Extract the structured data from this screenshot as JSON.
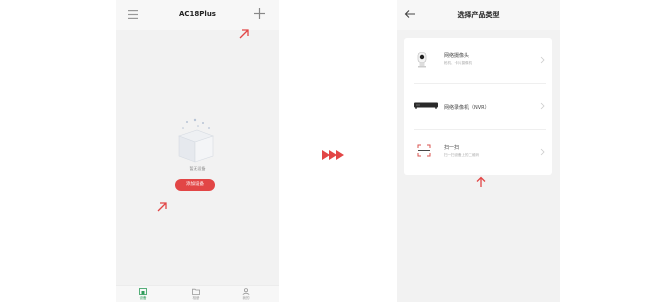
{
  "left_screen": {
    "title": "AC18Plus",
    "empty_text": "暂无设备",
    "add_button_label": "添加设备",
    "tabs": [
      {
        "label": "设备"
      },
      {
        "label": "相册"
      },
      {
        "label": "我的"
      }
    ]
  },
  "right_screen": {
    "title": "选择产品类型",
    "products": [
      {
        "title": "网络摄像头",
        "desc": "枪机、卡片摄像机"
      },
      {
        "title": "网络录像机（NVR）",
        "desc": ""
      },
      {
        "title": "扫一扫",
        "desc": "扫一扫设备上的二维码"
      }
    ]
  },
  "colors": {
    "accent_red": "#e24646",
    "tab_active": "#2f9c5a",
    "page_bg": "#f2f2f2"
  },
  "icons": [
    "menu-icon",
    "plus-icon",
    "back-icon",
    "arrow-icon",
    "chevron-right-icon",
    "camera-icon",
    "nvr-icon",
    "scan-icon",
    "empty-box-icon"
  ]
}
